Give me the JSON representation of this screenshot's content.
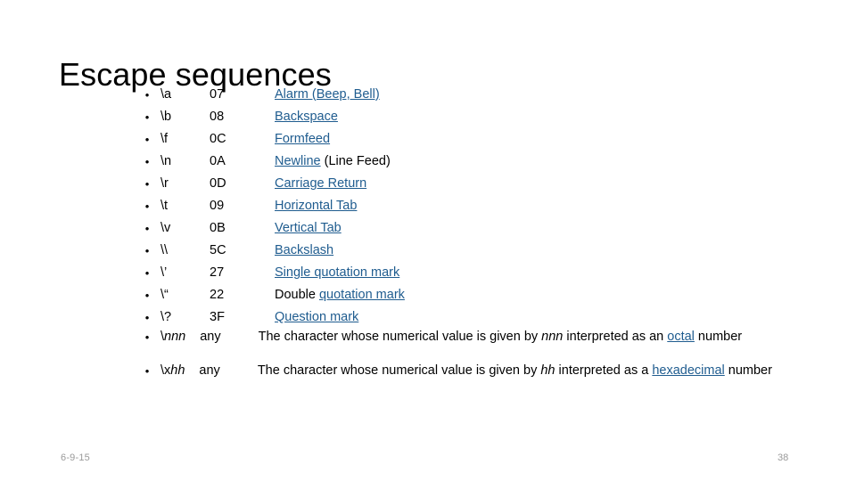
{
  "slide": {
    "title": "Escape sequences",
    "bullet_glyph": "•",
    "link_color": "#1F5C8F",
    "text_color": "#000000",
    "footer_color": "#9A9A9A",
    "background": "#FFFFFF"
  },
  "rows": [
    {
      "seq": "\\a",
      "code": "07",
      "desc_link": "Alarm (Beep, Bell)",
      "desc_plain_before": "",
      "desc_plain_after": ""
    },
    {
      "seq": "\\b",
      "code": "08",
      "desc_link": "Backspace",
      "desc_plain_before": "",
      "desc_plain_after": ""
    },
    {
      "seq": "\\f",
      "code": "0C",
      "desc_link": "Formfeed",
      "desc_plain_before": "",
      "desc_plain_after": ""
    },
    {
      "seq": "\\n",
      "code": "0A",
      "desc_link": "Newline",
      "desc_plain_before": "",
      "desc_plain_after": " (Line Feed)"
    },
    {
      "seq": "\\r",
      "code": "0D",
      "desc_link": "Carriage Return",
      "desc_plain_before": "",
      "desc_plain_after": ""
    },
    {
      "seq": "\\t",
      "code": "09",
      "desc_link": "Horizontal Tab",
      "desc_plain_before": "",
      "desc_plain_after": ""
    },
    {
      "seq": "\\v",
      "code": "0B",
      "desc_link": "Vertical Tab",
      "desc_plain_before": "",
      "desc_plain_after": ""
    },
    {
      "seq": "\\\\",
      "code": "5C",
      "desc_link": "Backslash",
      "desc_plain_before": "",
      "desc_plain_after": ""
    },
    {
      "seq": "\\’",
      "code": "27",
      "desc_link": "Single quotation mark",
      "desc_plain_before": "",
      "desc_plain_after": ""
    },
    {
      "seq": "\\“",
      "code": "22",
      "desc_link": "quotation mark",
      "desc_plain_before": "Double ",
      "desc_plain_after": ""
    },
    {
      "seq": "\\?",
      "code": "3F",
      "desc_link": "Question mark",
      "desc_plain_before": "",
      "desc_plain_after": ""
    }
  ],
  "wide_rows": [
    {
      "seq_prefix": "\\",
      "seq_italic": "nnn",
      "code": "any",
      "text_before": "The character whose numerical value is given by ",
      "italic_token": "nnn",
      "text_mid": " interpreted as an ",
      "link": "octal",
      "text_after": " number"
    },
    {
      "seq_prefix": "\\x",
      "seq_italic": "hh",
      "code": "any",
      "text_before": "The character whose numerical value is given by ",
      "italic_token": "hh",
      "text_mid": " interpreted as a ",
      "link": "hexadecimal",
      "text_after": " number"
    }
  ],
  "footer": {
    "date": "6-9-15",
    "page_number": "38"
  }
}
